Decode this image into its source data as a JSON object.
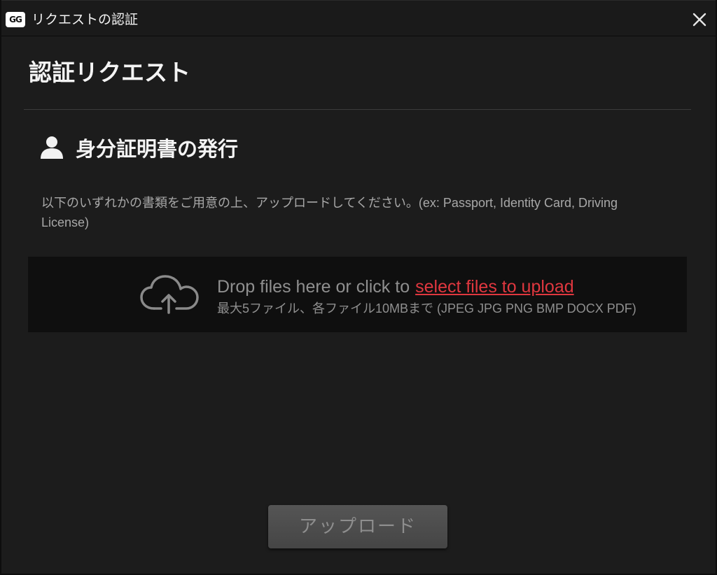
{
  "window": {
    "logo_text": "GG",
    "title": "リクエストの認証",
    "close_icon": "close-icon"
  },
  "page": {
    "heading": "認証リクエスト"
  },
  "section": {
    "icon": "user-icon",
    "title": "身分証明書の発行",
    "instructions": "以下のいずれかの書類をご用意の上、アップロードしてください。(ex: Passport, Identity Card, Driving License)"
  },
  "dropzone": {
    "icon": "cloud-upload-icon",
    "main_text": "Drop files here or click to",
    "link_text": "select files to upload",
    "sub_text": "最大5ファイル、各ファイル10MBまで (JPEG JPG PNG BMP DOCX PDF)"
  },
  "actions": {
    "upload_label": "アップロード",
    "upload_enabled": false
  },
  "colors": {
    "background": "#1c1c1c",
    "link": "#e0373f",
    "button": "#4d4d4d"
  }
}
